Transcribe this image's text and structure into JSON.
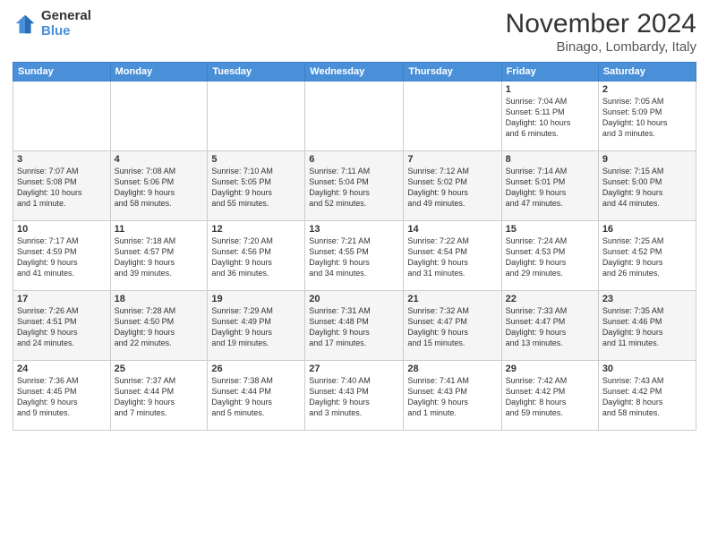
{
  "logo": {
    "general": "General",
    "blue": "Blue"
  },
  "title": "November 2024",
  "location": "Binago, Lombardy, Italy",
  "headers": [
    "Sunday",
    "Monday",
    "Tuesday",
    "Wednesday",
    "Thursday",
    "Friday",
    "Saturday"
  ],
  "weeks": [
    [
      {
        "day": "",
        "info": ""
      },
      {
        "day": "",
        "info": ""
      },
      {
        "day": "",
        "info": ""
      },
      {
        "day": "",
        "info": ""
      },
      {
        "day": "",
        "info": ""
      },
      {
        "day": "1",
        "info": "Sunrise: 7:04 AM\nSunset: 5:11 PM\nDaylight: 10 hours\nand 6 minutes."
      },
      {
        "day": "2",
        "info": "Sunrise: 7:05 AM\nSunset: 5:09 PM\nDaylight: 10 hours\nand 3 minutes."
      }
    ],
    [
      {
        "day": "3",
        "info": "Sunrise: 7:07 AM\nSunset: 5:08 PM\nDaylight: 10 hours\nand 1 minute."
      },
      {
        "day": "4",
        "info": "Sunrise: 7:08 AM\nSunset: 5:06 PM\nDaylight: 9 hours\nand 58 minutes."
      },
      {
        "day": "5",
        "info": "Sunrise: 7:10 AM\nSunset: 5:05 PM\nDaylight: 9 hours\nand 55 minutes."
      },
      {
        "day": "6",
        "info": "Sunrise: 7:11 AM\nSunset: 5:04 PM\nDaylight: 9 hours\nand 52 minutes."
      },
      {
        "day": "7",
        "info": "Sunrise: 7:12 AM\nSunset: 5:02 PM\nDaylight: 9 hours\nand 49 minutes."
      },
      {
        "day": "8",
        "info": "Sunrise: 7:14 AM\nSunset: 5:01 PM\nDaylight: 9 hours\nand 47 minutes."
      },
      {
        "day": "9",
        "info": "Sunrise: 7:15 AM\nSunset: 5:00 PM\nDaylight: 9 hours\nand 44 minutes."
      }
    ],
    [
      {
        "day": "10",
        "info": "Sunrise: 7:17 AM\nSunset: 4:59 PM\nDaylight: 9 hours\nand 41 minutes."
      },
      {
        "day": "11",
        "info": "Sunrise: 7:18 AM\nSunset: 4:57 PM\nDaylight: 9 hours\nand 39 minutes."
      },
      {
        "day": "12",
        "info": "Sunrise: 7:20 AM\nSunset: 4:56 PM\nDaylight: 9 hours\nand 36 minutes."
      },
      {
        "day": "13",
        "info": "Sunrise: 7:21 AM\nSunset: 4:55 PM\nDaylight: 9 hours\nand 34 minutes."
      },
      {
        "day": "14",
        "info": "Sunrise: 7:22 AM\nSunset: 4:54 PM\nDaylight: 9 hours\nand 31 minutes."
      },
      {
        "day": "15",
        "info": "Sunrise: 7:24 AM\nSunset: 4:53 PM\nDaylight: 9 hours\nand 29 minutes."
      },
      {
        "day": "16",
        "info": "Sunrise: 7:25 AM\nSunset: 4:52 PM\nDaylight: 9 hours\nand 26 minutes."
      }
    ],
    [
      {
        "day": "17",
        "info": "Sunrise: 7:26 AM\nSunset: 4:51 PM\nDaylight: 9 hours\nand 24 minutes."
      },
      {
        "day": "18",
        "info": "Sunrise: 7:28 AM\nSunset: 4:50 PM\nDaylight: 9 hours\nand 22 minutes."
      },
      {
        "day": "19",
        "info": "Sunrise: 7:29 AM\nSunset: 4:49 PM\nDaylight: 9 hours\nand 19 minutes."
      },
      {
        "day": "20",
        "info": "Sunrise: 7:31 AM\nSunset: 4:48 PM\nDaylight: 9 hours\nand 17 minutes."
      },
      {
        "day": "21",
        "info": "Sunrise: 7:32 AM\nSunset: 4:47 PM\nDaylight: 9 hours\nand 15 minutes."
      },
      {
        "day": "22",
        "info": "Sunrise: 7:33 AM\nSunset: 4:47 PM\nDaylight: 9 hours\nand 13 minutes."
      },
      {
        "day": "23",
        "info": "Sunrise: 7:35 AM\nSunset: 4:46 PM\nDaylight: 9 hours\nand 11 minutes."
      }
    ],
    [
      {
        "day": "24",
        "info": "Sunrise: 7:36 AM\nSunset: 4:45 PM\nDaylight: 9 hours\nand 9 minutes."
      },
      {
        "day": "25",
        "info": "Sunrise: 7:37 AM\nSunset: 4:44 PM\nDaylight: 9 hours\nand 7 minutes."
      },
      {
        "day": "26",
        "info": "Sunrise: 7:38 AM\nSunset: 4:44 PM\nDaylight: 9 hours\nand 5 minutes."
      },
      {
        "day": "27",
        "info": "Sunrise: 7:40 AM\nSunset: 4:43 PM\nDaylight: 9 hours\nand 3 minutes."
      },
      {
        "day": "28",
        "info": "Sunrise: 7:41 AM\nSunset: 4:43 PM\nDaylight: 9 hours\nand 1 minute."
      },
      {
        "day": "29",
        "info": "Sunrise: 7:42 AM\nSunset: 4:42 PM\nDaylight: 8 hours\nand 59 minutes."
      },
      {
        "day": "30",
        "info": "Sunrise: 7:43 AM\nSunset: 4:42 PM\nDaylight: 8 hours\nand 58 minutes."
      }
    ]
  ]
}
